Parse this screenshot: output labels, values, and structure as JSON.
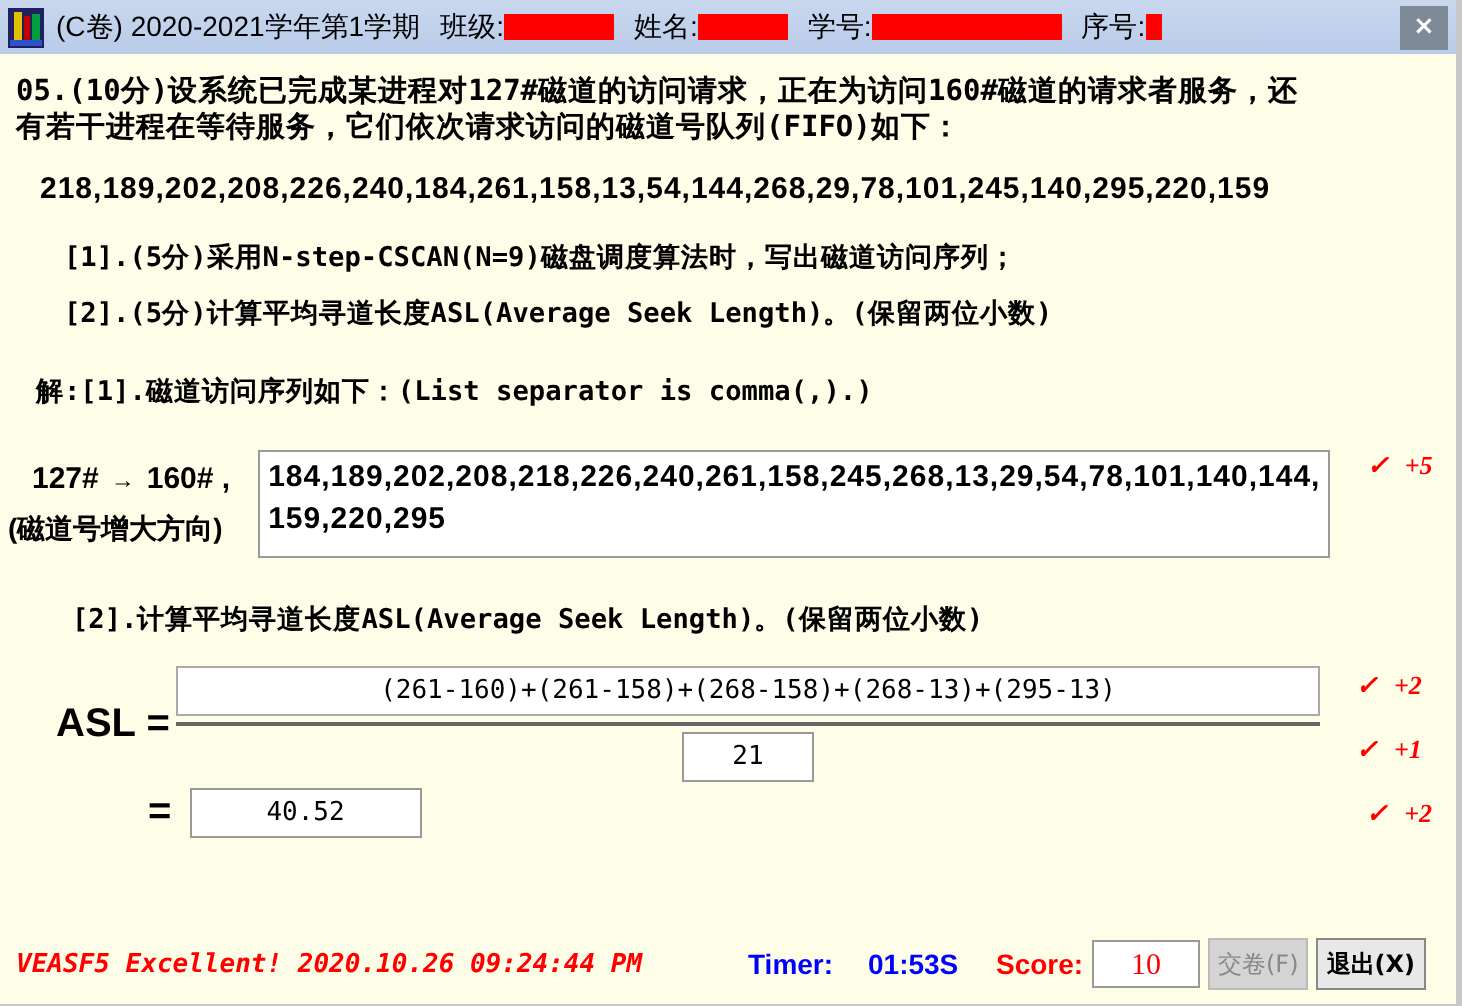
{
  "window": {
    "title": "(C卷) 2020-2021学年第1学期",
    "fields": [
      {
        "label": "班级:"
      },
      {
        "label": "姓名:"
      },
      {
        "label": "学号:"
      },
      {
        "label": "序号:"
      }
    ],
    "close": "×"
  },
  "question": {
    "text": "05.(10分)设系统已完成某进程对127#磁道的访问请求，正在为访问160#磁道的请求者服务，还有若干进程在等待服务，它们依次请求访问的磁道号队列(FIFO)如下：",
    "queue": "218,189,202,208,226,240,184,261,158,13,54,144,268,29,78,101,245,140,295,220,159",
    "parts": [
      "[1].(5分)采用N-step-CSCAN(N=9)磁盘调度算法时，写出磁道访问序列；",
      "[2].(5分)计算平均寻道长度ASL(Average Seek Length)。(保留两位小数)"
    ]
  },
  "answer1": {
    "heading": "解:[1].磁道访问序列如下：(List separator is comma(,).)",
    "start": "127#",
    "arrow": "→",
    "end": "160# ,",
    "direction": "(磁道号增大方向)",
    "value": "184,189,202,208,218,226,240,261,158,245,268,13,29,54,78,101,140,144,159,220,295",
    "mark": {
      "symbol": "✓",
      "points": "+5"
    }
  },
  "answer2": {
    "heading": "[2].计算平均寻道长度ASL(Average Seek Length)。(保留两位小数)",
    "label": "ASL =",
    "numerator": "(261-160)+(261-158)+(268-158)+(268-13)+(295-13)",
    "denominator": "21",
    "equals": "=",
    "result": "40.52",
    "marks": [
      {
        "symbol": "✓",
        "points": "+2"
      },
      {
        "symbol": "✓",
        "points": "+1"
      },
      {
        "symbol": "✓",
        "points": "+2"
      }
    ]
  },
  "status_bar": {
    "message": "VEASF5 Excellent! 2020.10.26 09:24:44 PM",
    "timer_label": "Timer:",
    "timer": "01:53S",
    "score_label": "Score:",
    "score": "10",
    "buttons": [
      {
        "label": "交卷(F)",
        "disabled": true
      },
      {
        "label": "退出(X)",
        "disabled": false
      }
    ]
  }
}
